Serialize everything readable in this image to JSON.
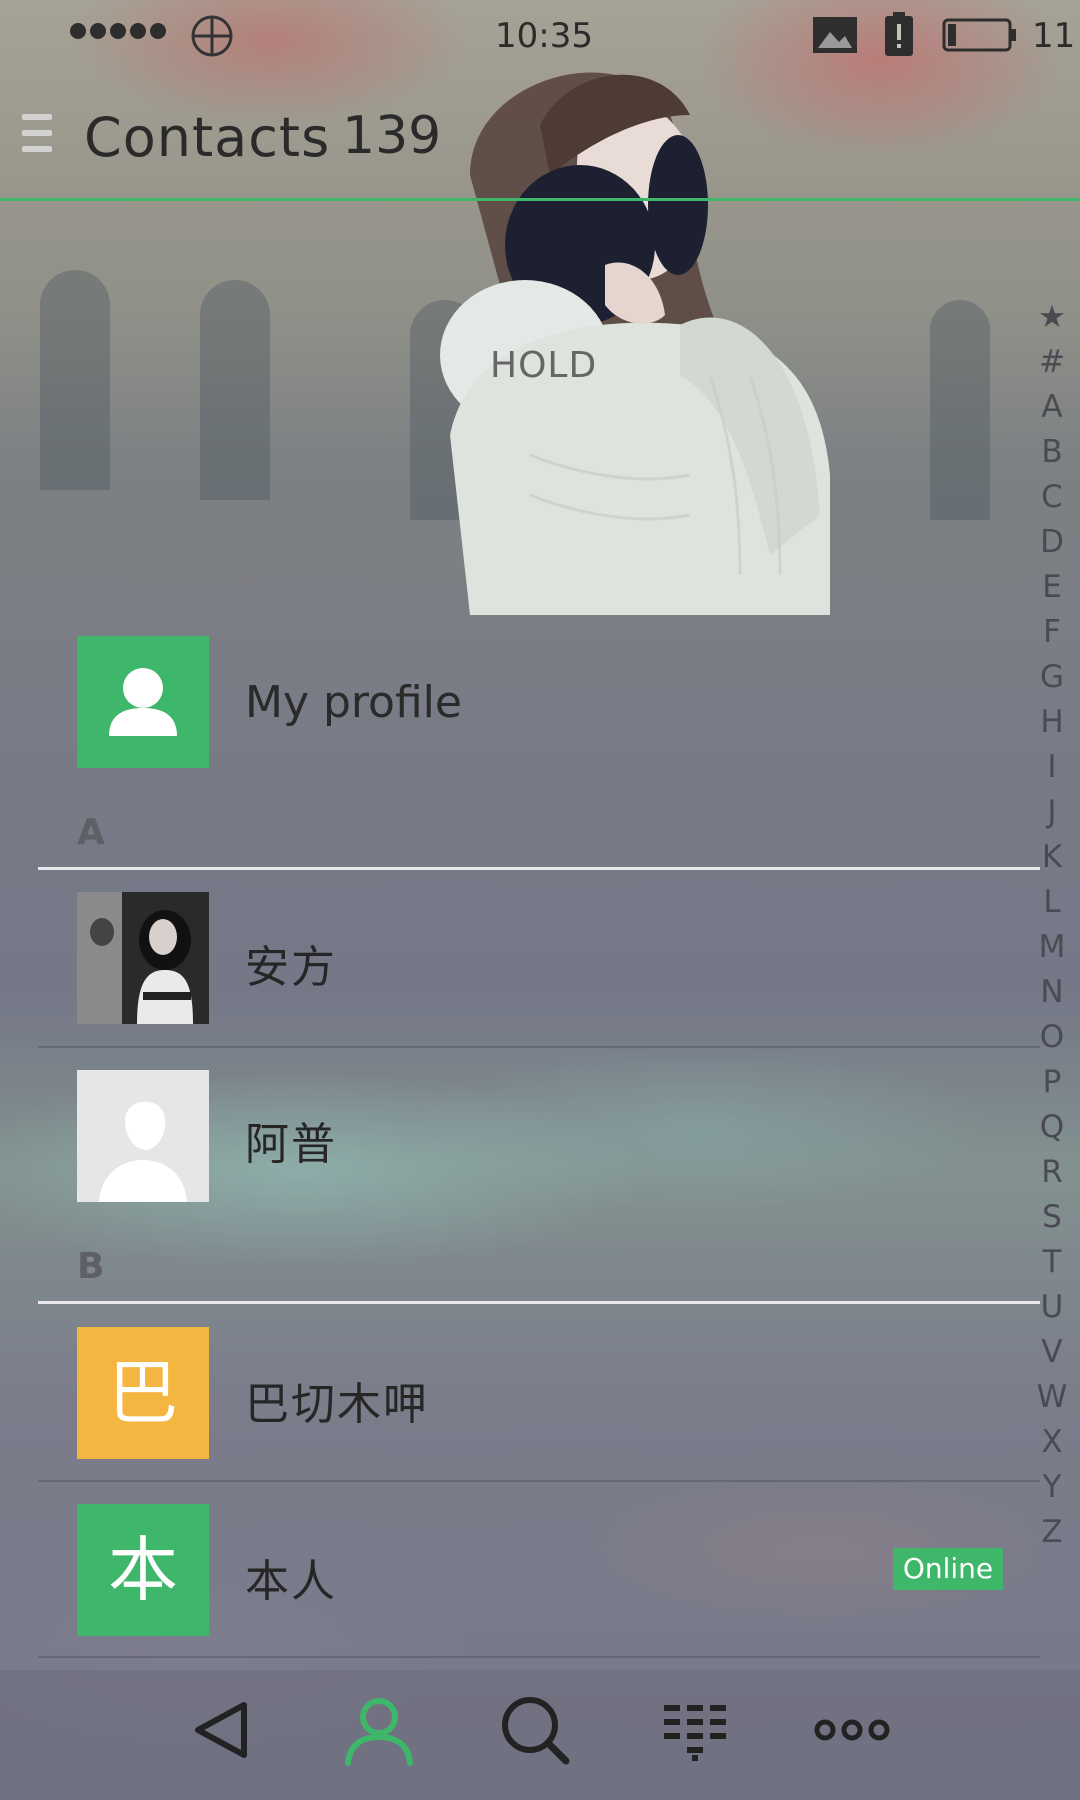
{
  "status_bar": {
    "time": "10:35",
    "battery": "11",
    "icons": [
      "signal-dots-icon",
      "globe-icon",
      "image-icon",
      "battery-alert-icon",
      "battery-icon"
    ]
  },
  "header": {
    "title": "Contacts",
    "count": "139",
    "menu_icon": "menu-icon",
    "accent_color": "#3fb76a"
  },
  "hold_label": "HOLD",
  "alphabet_index": [
    "★",
    "#",
    "A",
    "B",
    "C",
    "D",
    "E",
    "F",
    "G",
    "H",
    "I",
    "J",
    "K",
    "L",
    "M",
    "N",
    "O",
    "P",
    "Q",
    "R",
    "S",
    "T",
    "U",
    "V",
    "W",
    "X",
    "Y",
    "Z"
  ],
  "my_profile": {
    "label": "My profile",
    "icon": "person-icon",
    "color": "#3fb76a"
  },
  "sections": [
    {
      "letter": "A",
      "contacts": [
        {
          "name": "安方",
          "avatar": "photo"
        },
        {
          "name": "阿普",
          "avatar": "default-silhouette"
        }
      ]
    },
    {
      "letter": "B",
      "contacts": [
        {
          "name": "巴切木呷",
          "avatar_char": "巴",
          "avatar_color": "#f5b541"
        },
        {
          "name": "本人",
          "avatar_char": "本",
          "avatar_color": "#3fb76a",
          "badge": "Online"
        }
      ]
    }
  ],
  "bottom_nav": [
    "back-icon",
    "contacts-icon",
    "search-icon",
    "dialpad-icon",
    "more-icon"
  ]
}
